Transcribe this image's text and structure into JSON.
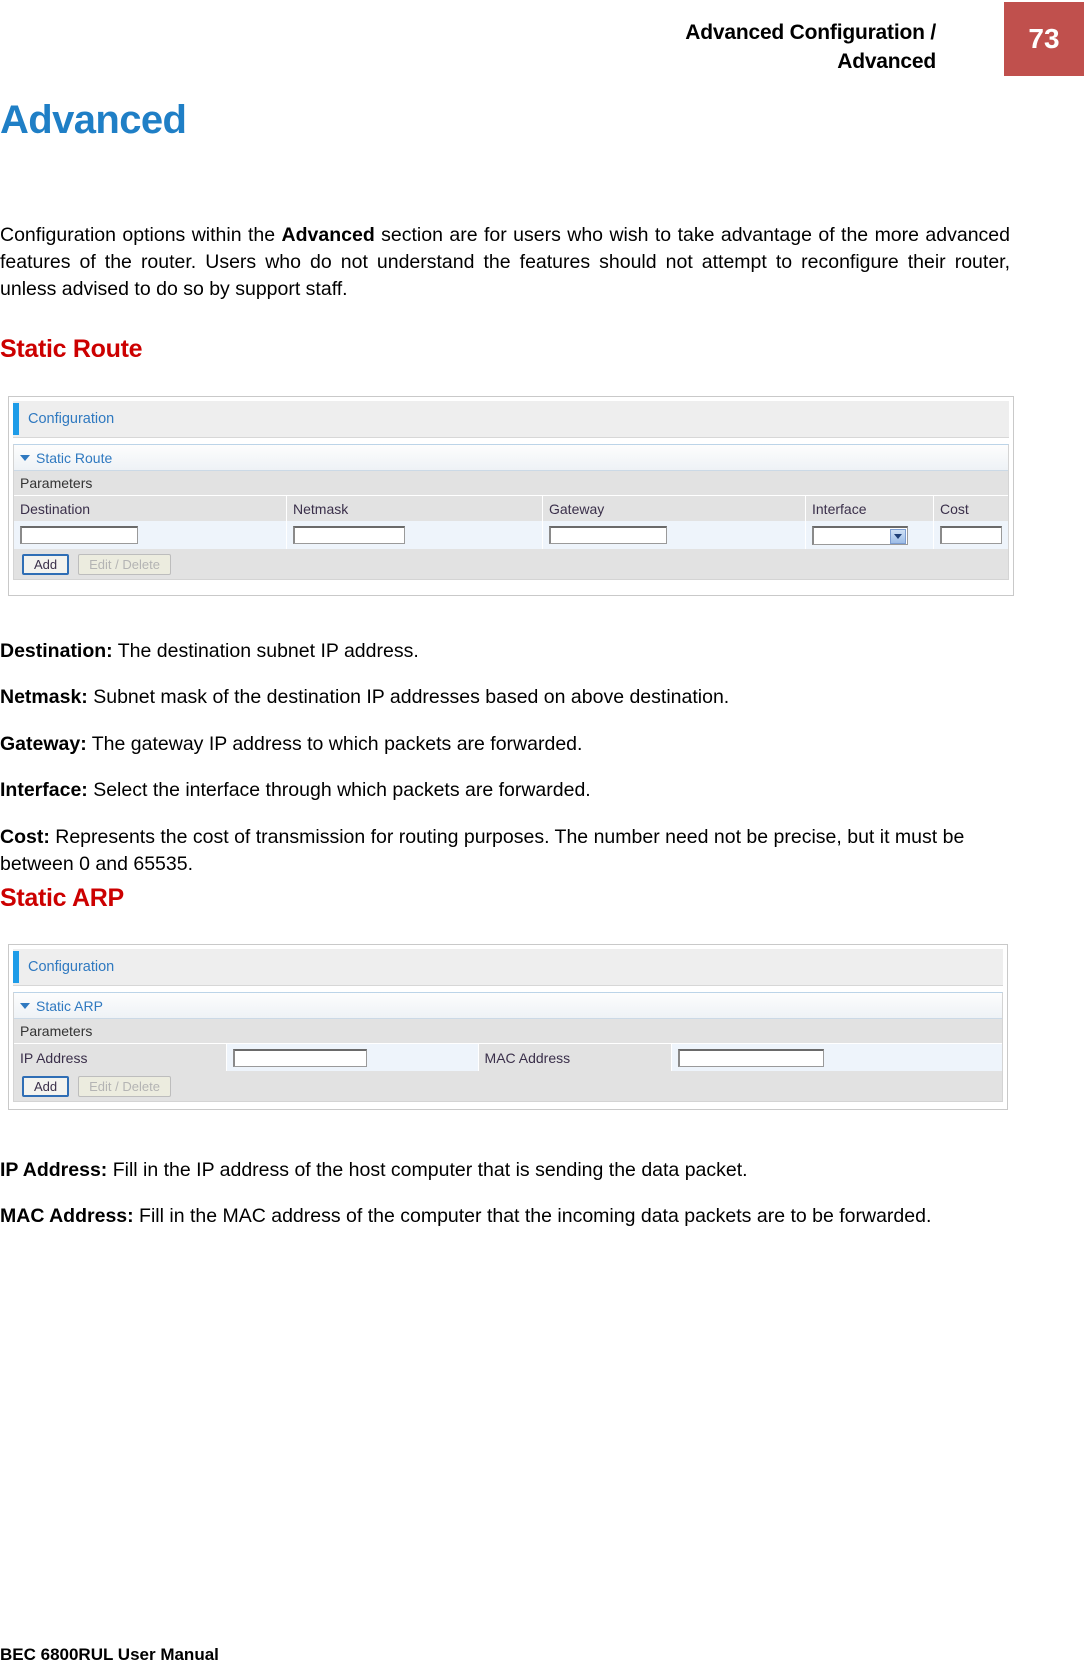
{
  "header": {
    "title_line1": "Advanced Configuration /",
    "title_line2": "Advanced",
    "page_number": "73",
    "badge_color": "#c0504d"
  },
  "doc": {
    "title": "Advanced",
    "title_color": "#1f7fc6",
    "intro_part1": "Configuration options within the ",
    "intro_bold": "Advanced",
    "intro_part2": " section are for users who wish to take advantage of the more advanced features of the router. Users who do not understand the features should not attempt to reconfigure their router, unless advised to do so by support staff.",
    "section_heading_color": "#cc0000"
  },
  "static_route": {
    "heading": "Static Route",
    "panel": {
      "configuration_label": "Configuration",
      "section_label": "Static Route",
      "parameters_label": "Parameters",
      "columns": [
        "Destination",
        "Netmask",
        "Gateway",
        "Interface",
        "Cost"
      ],
      "fields": {
        "destination_value": "",
        "netmask_value": "",
        "gateway_value": "",
        "interface_value": "",
        "cost_value": ""
      },
      "buttons": {
        "add_label": "Add",
        "edit_delete_label": "Edit / Delete"
      }
    },
    "definitions": [
      {
        "term": "Destination:",
        "text": " The destination subnet IP address."
      },
      {
        "term": "Netmask:",
        "text": " Subnet mask of the destination IP addresses based on above destination."
      },
      {
        "term": "Gateway:",
        "text": " The gateway IP address to which packets are forwarded."
      },
      {
        "term": "Interface:",
        "text": " Select the interface through which packets are forwarded."
      },
      {
        "term": "Cost:",
        "text": " Represents the cost of transmission for routing purposes. The number need not be precise, but it must be between 0 and 65535."
      }
    ]
  },
  "static_arp": {
    "heading": "Static ARP",
    "panel": {
      "configuration_label": "Configuration",
      "section_label": "Static ARP",
      "parameters_label": "Parameters",
      "columns": [
        "IP Address",
        "MAC Address"
      ],
      "fields": {
        "ip_address_value": "",
        "mac_address_value": ""
      },
      "buttons": {
        "add_label": "Add",
        "edit_delete_label": "Edit / Delete"
      }
    },
    "definitions": [
      {
        "term": "IP Address:",
        "text": " Fill in the IP address of the host computer that is sending the data packet."
      },
      {
        "term": "MAC Address:",
        "text": " Fill in the MAC address of the computer that the incoming data packets are to be forwarded."
      }
    ]
  },
  "footer": {
    "text": "BEC 6800RUL User Manual"
  }
}
